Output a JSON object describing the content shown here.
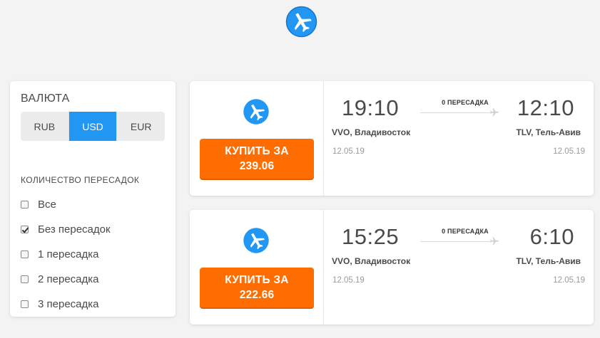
{
  "header": {
    "logo_icon": "airplane-logo-icon"
  },
  "filters": {
    "currency_title": "ВАЛЮТА",
    "currencies": [
      {
        "label": "RUB",
        "active": false
      },
      {
        "label": "USD",
        "active": true
      },
      {
        "label": "EUR",
        "active": false
      }
    ],
    "stops_title": "КОЛИЧЕСТВО ПЕРЕСАДОК",
    "stops": [
      {
        "label": "Все",
        "checked": false
      },
      {
        "label": "Без пересадок",
        "checked": true
      },
      {
        "label": "1 пересадка",
        "checked": false
      },
      {
        "label": "2 пересадка",
        "checked": false
      },
      {
        "label": "3 пересадка",
        "checked": false
      }
    ]
  },
  "tickets": [
    {
      "buy_label": "КУПИТЬ ЗА",
      "price": "239.06",
      "departure_time": "19:10",
      "arrival_time": "12:10",
      "stops_label": "0 ПЕРЕСАДКА",
      "departure_city": "VVO, Владивосток",
      "arrival_city": "TLV, Тель-Авив",
      "departure_date": "12.05.19",
      "arrival_date": "12.05.19"
    },
    {
      "buy_label": "КУПИТЬ ЗА",
      "price": "222.66",
      "departure_time": "15:25",
      "arrival_time": "6:10",
      "stops_label": "0 ПЕРЕСАДКА",
      "departure_city": "VVO, Владивосток",
      "arrival_city": "TLV, Тель-Авив",
      "departure_date": "12.05.19",
      "arrival_date": "12.05.19"
    }
  ],
  "colors": {
    "accent_blue": "#2196f3",
    "buy_orange": "#ff6d00"
  }
}
